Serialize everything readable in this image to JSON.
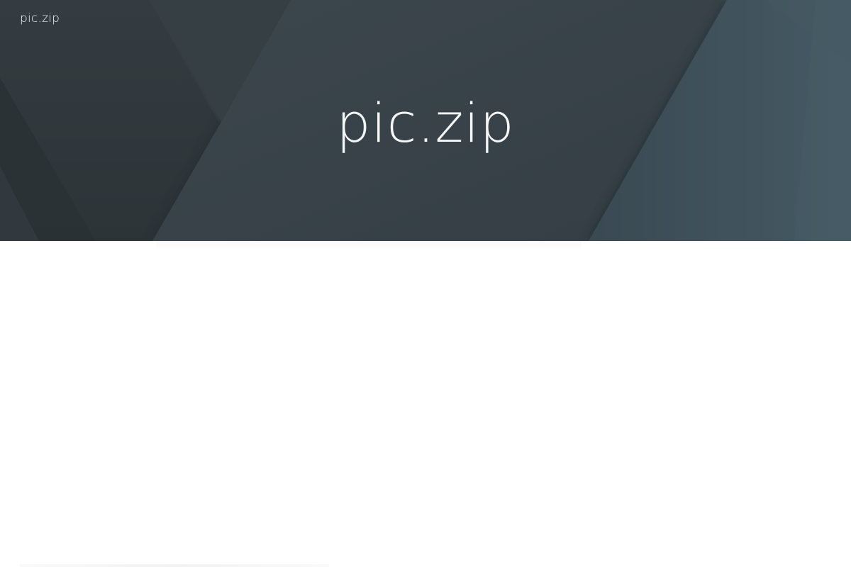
{
  "header": {
    "site_name": "pic.zip"
  },
  "hero": {
    "title": "pic.zip"
  },
  "colors": {
    "hero_base": "#353f45",
    "hero_dark": "#2b3338",
    "hero_mid": "#3a444a",
    "hero_teal": "#3c4c56",
    "text_light": "#f4f6f7",
    "page_background": "#ffffff"
  }
}
